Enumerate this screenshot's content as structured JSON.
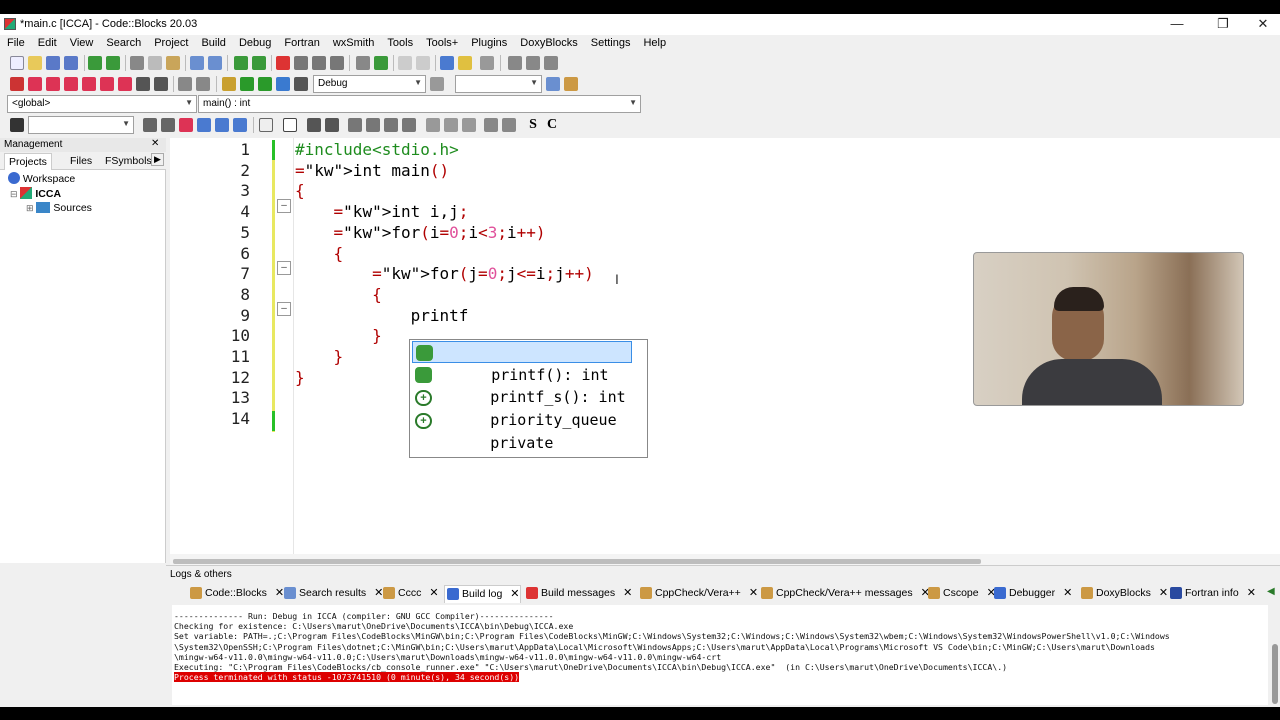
{
  "window": {
    "title": "*main.c [ICCA] - Code::Blocks 20.03"
  },
  "menu": [
    "File",
    "Edit",
    "View",
    "Search",
    "Project",
    "Build",
    "Debug",
    "Fortran",
    "wxSmith",
    "Tools",
    "Tools+",
    "Plugins",
    "DoxyBlocks",
    "Settings",
    "Help"
  ],
  "toolbar": {
    "build_target": "Debug",
    "scope": "<global>",
    "function": "main() : int"
  },
  "management": {
    "title": "Management",
    "tabs": [
      "Projects",
      "Files",
      "FSymbols"
    ],
    "tree": {
      "workspace": "Workspace",
      "project": "ICCA",
      "folder": "Sources"
    }
  },
  "editor": {
    "line_numbers": [
      "1",
      "2",
      "3",
      "4",
      "5",
      "6",
      "7",
      "8",
      "9",
      "10",
      "11",
      "12",
      "13",
      "14"
    ],
    "lines": [
      "#include<stdio.h>",
      "int main()",
      "{",
      "    int i,j;",
      "    for(i=0;i<3;i++)",
      "    {",
      "        for(j=0;j<=i;j++)",
      "        {",
      "            printf",
      "        }",
      "    }",
      "}",
      "",
      ""
    ]
  },
  "autocomplete": {
    "items": [
      {
        "label": "printf(): int",
        "icon": "function-icon",
        "selected": true
      },
      {
        "label": "printf_s(): int",
        "icon": "function-icon",
        "selected": false
      },
      {
        "label": "priority_queue",
        "icon": "class-icon",
        "selected": false
      },
      {
        "label": "private",
        "icon": "class-icon",
        "selected": false
      }
    ]
  },
  "logs": {
    "title": "Logs & others",
    "tabs": [
      "Code::Blocks",
      "Search results",
      "Cccc",
      "Build log",
      "Build messages",
      "CppCheck/Vera++",
      "CppCheck/Vera++ messages",
      "Cscope",
      "Debugger",
      "DoxyBlocks",
      "Fortran info"
    ],
    "lines": [
      "-------------- Run: Debug in ICCA (compiler: GNU GCC Compiler)---------------",
      "",
      "Checking for existence: C:\\Users\\marut\\OneDrive\\Documents\\ICCA\\bin\\Debug\\ICCA.exe",
      "Set variable: PATH=.;C:\\Program Files\\CodeBlocks\\MinGW\\bin;C:\\Program Files\\CodeBlocks\\MinGW;C:\\Windows\\System32;C:\\Windows;C:\\Windows\\System32\\wbem;C:\\Windows\\System32\\WindowsPowerShell\\v1.0;C:\\Windows",
      "\\System32\\OpenSSH;C:\\Program Files\\dotnet;C:\\MinGW\\bin;C:\\Users\\marut\\AppData\\Local\\Microsoft\\WindowsApps;C:\\Users\\marut\\AppData\\Local\\Programs\\Microsoft VS Code\\bin;C:\\MinGW;C:\\Users\\marut\\Downloads",
      "\\mingw-w64-v11.0.0\\mingw-w64-v11.0.0;C:\\Users\\marut\\Downloads\\mingw-w64-v11.0.0\\mingw-w64-v11.0.0\\mingw-w64-crt",
      "Executing: \"C:\\Program Files\\CodeBlocks/cb_console_runner.exe\" \"C:\\Users\\marut\\OneDrive\\Documents\\ICCA\\bin\\Debug\\ICCA.exe\"  (in C:\\Users\\marut\\OneDrive\\Documents\\ICCA\\.)"
    ],
    "status_line": "Process terminated with status -1073741510 (0 minute(s), 34 second(s))"
  }
}
